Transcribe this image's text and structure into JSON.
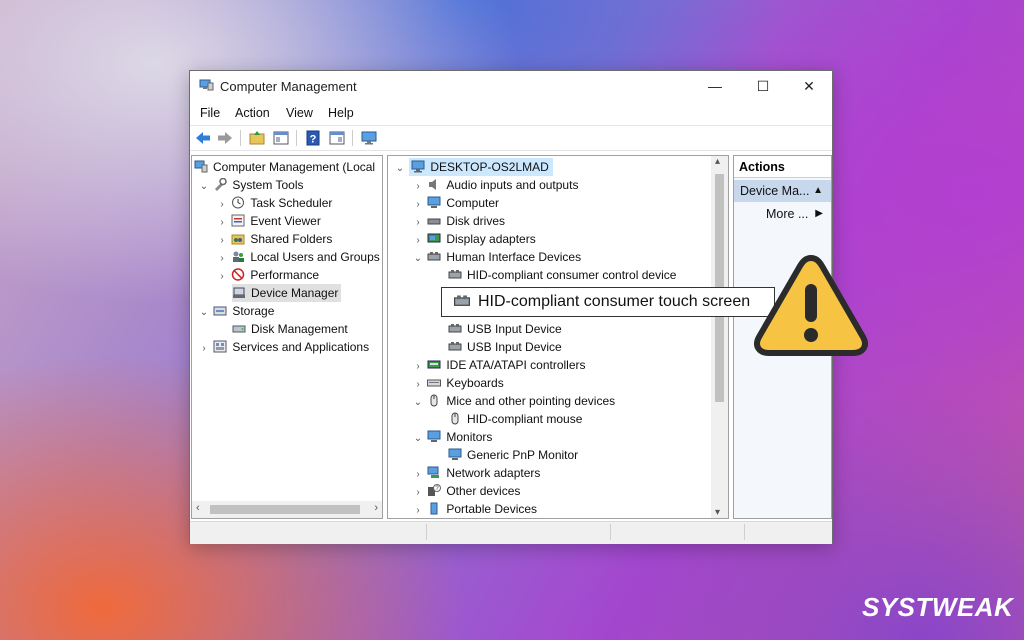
{
  "window": {
    "title": "Computer Management",
    "controls": {
      "minimize": "—",
      "maximize": "☐",
      "close": "✕"
    }
  },
  "menu": [
    "File",
    "Action",
    "View",
    "Help"
  ],
  "left_tree": [
    {
      "label": "Computer Management (Local",
      "icon": "computer-management-icon"
    },
    {
      "label": "System Tools",
      "icon": "system-tools-icon"
    },
    {
      "label": "Task Scheduler",
      "icon": "clock-icon"
    },
    {
      "label": "Event Viewer",
      "icon": "event-viewer-icon"
    },
    {
      "label": "Shared Folders",
      "icon": "shared-folder-icon"
    },
    {
      "label": "Local Users and Groups",
      "icon": "users-icon"
    },
    {
      "label": "Performance",
      "icon": "performance-icon"
    },
    {
      "label": "Device Manager",
      "icon": "device-manager-icon"
    },
    {
      "label": "Storage",
      "icon": "storage-icon"
    },
    {
      "label": "Disk Management",
      "icon": "disk-icon"
    },
    {
      "label": "Services and Applications",
      "icon": "services-icon"
    }
  ],
  "device_tree": [
    {
      "label": "DESKTOP-OS2LMAD",
      "icon": "computer-icon"
    },
    {
      "label": "Audio inputs and outputs",
      "icon": "speaker-icon"
    },
    {
      "label": "Computer",
      "icon": "monitor-icon"
    },
    {
      "label": "Disk drives",
      "icon": "disk-drive-icon"
    },
    {
      "label": "Display adapters",
      "icon": "display-adapter-icon"
    },
    {
      "label": "Human Interface Devices",
      "icon": "hid-icon"
    },
    {
      "label": "HID-compliant consumer control device",
      "icon": "hid-icon"
    },
    {
      "label": "USB Input Device",
      "icon": "hid-icon"
    },
    {
      "label": "USB Input Device",
      "icon": "hid-icon"
    },
    {
      "label": "IDE ATA/ATAPI controllers",
      "icon": "ide-icon"
    },
    {
      "label": "Keyboards",
      "icon": "keyboard-icon"
    },
    {
      "label": "Mice and other pointing devices",
      "icon": "mouse-icon"
    },
    {
      "label": "HID-compliant mouse",
      "icon": "mouse-icon"
    },
    {
      "label": "Monitors",
      "icon": "monitor-icon"
    },
    {
      "label": "Generic PnP Monitor",
      "icon": "monitor-icon"
    },
    {
      "label": "Network adapters",
      "icon": "network-icon"
    },
    {
      "label": "Other devices",
      "icon": "unknown-device-icon"
    },
    {
      "label": "Portable Devices",
      "icon": "portable-device-icon"
    }
  ],
  "callout": {
    "label": "HID-compliant consumer touch screen"
  },
  "actions": {
    "header": "Actions",
    "selected": "Device Ma...",
    "more": "More ..."
  },
  "brand": "SYSTWEAK",
  "colors": {
    "selection_blue": "#cce8ff",
    "actions_selected": "#c8d8ec",
    "warning_yellow": "#f6c343"
  }
}
